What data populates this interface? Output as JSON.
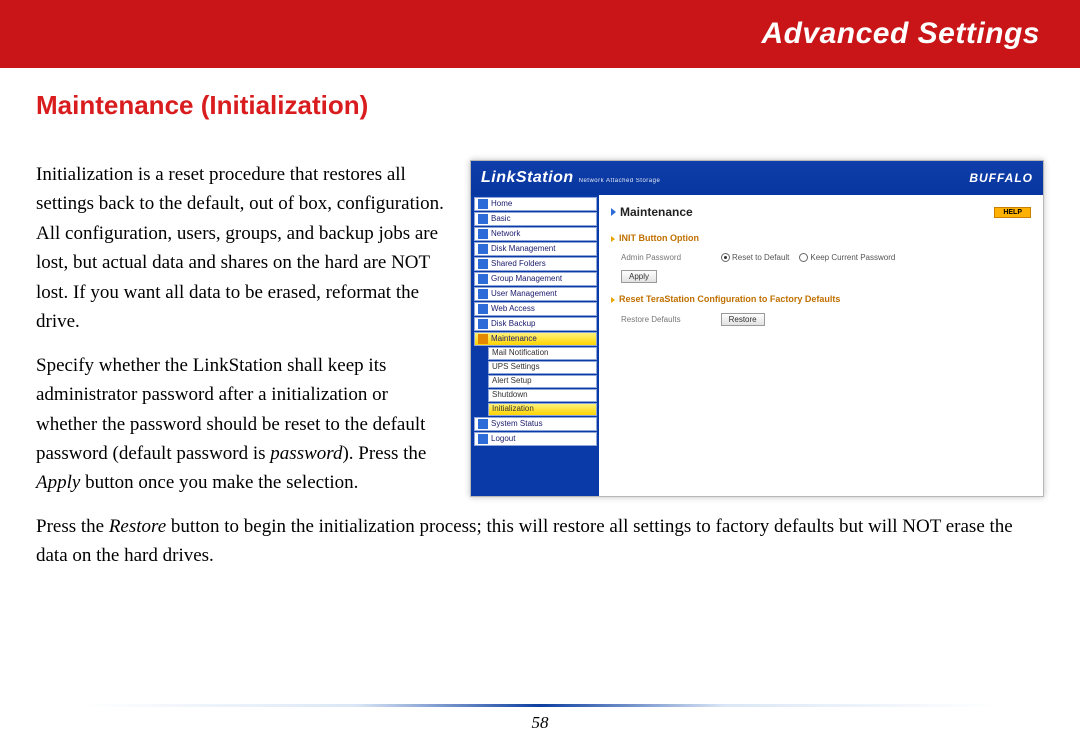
{
  "banner": {
    "title": "Advanced Settings"
  },
  "section": {
    "heading": "Maintenance (Initialization)"
  },
  "para": {
    "p1a": "Initialization is a reset procedure that restores all settings back to the default, out of box, configuration.  All configuration, users, groups, and backup jobs are lost, but actual data and shares on the hard are NOT lost.  If you want all data to be erased, reformat the drive.",
    "p2a": "Specify whether the LinkStation shall keep its administrator password after a initialization or whether the password should be reset to the default password (default password is ",
    "p2b": "password",
    "p2c": ").  Press the ",
    "p2d": "Apply",
    "p2e": " button once you make the selection.",
    "p3a": "Press the ",
    "p3b": "Restore",
    "p3c": " button to begin the initialization process; this will restore all settings to factory defaults but will NOT erase the data on the hard drives."
  },
  "pageNumber": "58",
  "ui": {
    "brand": "LinkStation",
    "brandSub": "Network Attached Storage",
    "logo": "BUFFALO",
    "help": "HELP",
    "pageTitle": "Maintenance",
    "nav": {
      "home": "Home",
      "basic": "Basic",
      "network": "Network",
      "disk": "Disk Management",
      "shared": "Shared Folders",
      "group": "Group Management",
      "user": "User Management",
      "web": "Web Access",
      "backup": "Disk Backup",
      "maint": "Maintenance",
      "mail": "Mail Notification",
      "ups": "UPS Settings",
      "alert": "Alert Setup",
      "shutdown": "Shutdown",
      "init": "Initialization",
      "status": "System Status",
      "logout": "Logout"
    },
    "group1": {
      "title": "INIT Button Option",
      "label": "Admin Password",
      "opt1": "Reset to Default",
      "opt2": "Keep Current Password",
      "apply": "Apply"
    },
    "group2": {
      "title": "Reset TeraStation Configuration to Factory Defaults",
      "label": "Restore Defaults",
      "restore": "Restore"
    }
  }
}
